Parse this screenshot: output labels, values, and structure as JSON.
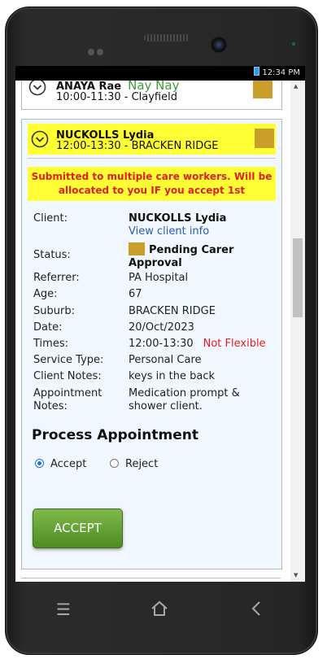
{
  "device": {
    "status_time": "12:34 PM"
  },
  "appointments": [
    {
      "client_name": "ANAYA Rae",
      "nickname": "Nay Nay",
      "time_location": "10:00-11:30 - Clayfield"
    },
    {
      "client_name": "NUCKOLLS Lydia",
      "time_location": "12:00-13:30 - BRACKEN RIDGE",
      "notice": "Submitted to multiple care workers. Will be allocated to you IF you accept 1st",
      "details": {
        "client_label": "Client:",
        "client_value": "NUCKOLLS Lydia",
        "view_client_link": "View client info",
        "status_label": "Status:",
        "status_value": "Pending Carer Approval",
        "referrer_label": "Referrer:",
        "referrer_value": "PA Hospital",
        "age_label": "Age:",
        "age_value": "67",
        "suburb_label": "Suburb:",
        "suburb_value": "BRACKEN RIDGE",
        "date_label": "Date:",
        "date_value": "20/Oct/2023",
        "times_label": "Times:",
        "times_value": "12:00-13:30",
        "times_flag": "Not Flexible",
        "service_label": "Service Type:",
        "service_value": "Personal Care",
        "client_notes_label": "Client Notes:",
        "client_notes_value": "keys in the back",
        "appt_notes_label": "Appointment Notes:",
        "appt_notes_value": "Medication prompt & shower client."
      },
      "process": {
        "title": "Process Appointment",
        "accept_label": "Accept",
        "reject_label": "Reject",
        "selected": "accept",
        "button_label": "ACCEPT"
      }
    }
  ],
  "colors": {
    "status_swatch": "#c99e2a",
    "highlight": "#ffff33",
    "warning_text": "#e0201f",
    "nickname": "#3aa03a",
    "accept_button": "#5e9a30"
  }
}
